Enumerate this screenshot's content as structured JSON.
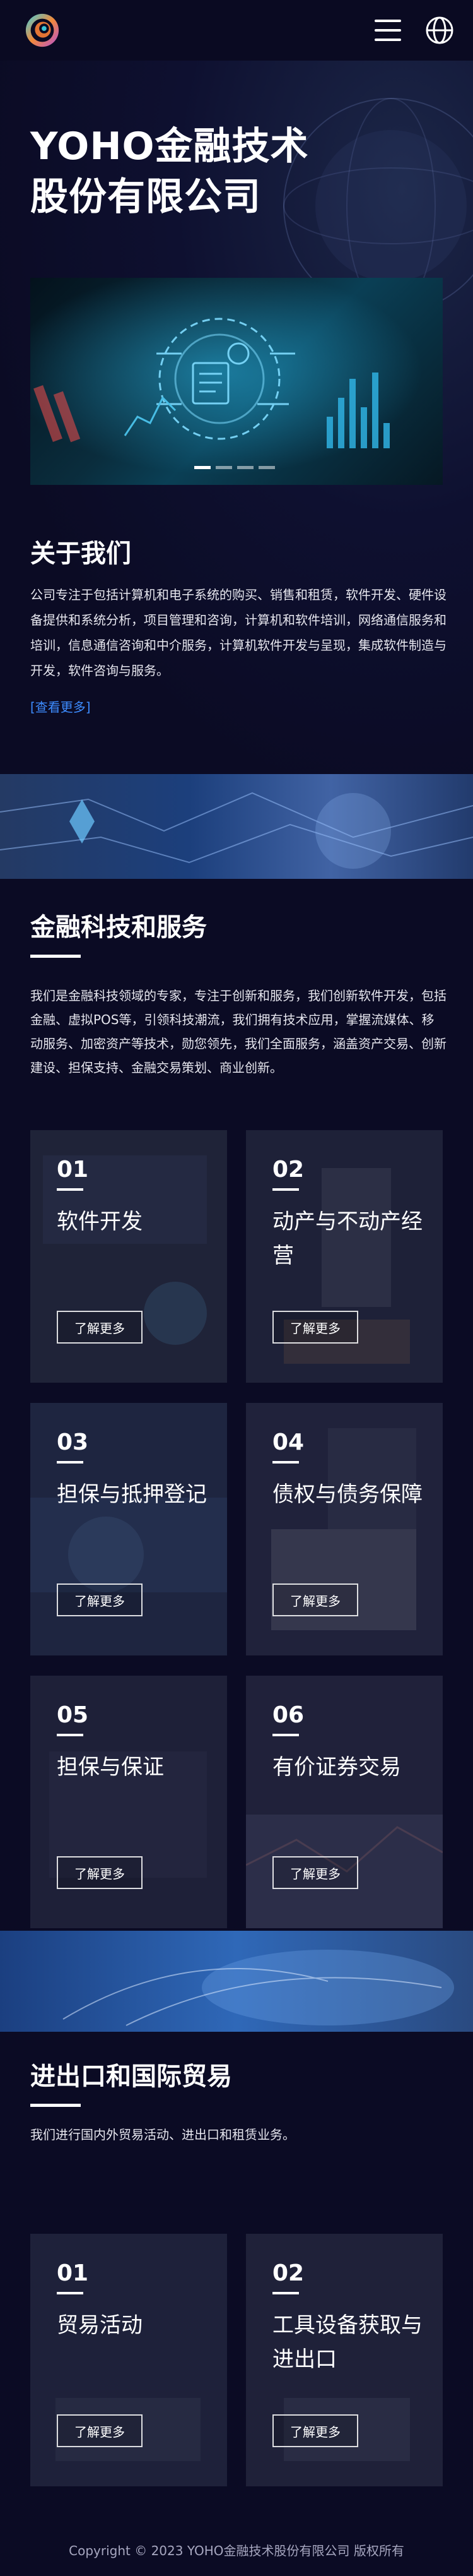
{
  "header": {
    "logo_icon": "swirl-logo-icon",
    "menu_icon": "hamburger-menu-icon",
    "language_icon": "globe-icon"
  },
  "hero": {
    "title_line1": "YOHO金融技术",
    "title_line2": "股份有限公司",
    "carousel_count": 4,
    "carousel_active": 1
  },
  "about": {
    "title": "关于我们",
    "text": "公司专注于包括计算机和电子系统的购买、销售和租赁，软件开发、硬件设备提供和系统分析，项目管理和咨询，计算机和软件培训，网络通信服务和培训，信息通信咨询和中介服务，计算机软件开发与呈现，集成软件制造与开发，软件咨询与服务。",
    "more_link": "[查看更多]"
  },
  "fintech": {
    "title": "金融科技和服务",
    "desc": "我们是金融科技领域的专家，专注于创新和服务，我们创新软件开发，包括金融、虚拟POS等，引领科技潮流，我们拥有技术应用，掌握流媒体、移动服务、加密资产等技术，勋您领先，我们全面服务，涵盖资产交易、创新建设、担保支持、金融交易策划、商业创新。",
    "cards": [
      {
        "num": "01",
        "title": "软件开发",
        "button": "了解更多"
      },
      {
        "num": "02",
        "title": "动产与不动产经营",
        "button": "了解更多"
      },
      {
        "num": "03",
        "title": "担保与抵押登记",
        "button": "了解更多"
      },
      {
        "num": "04",
        "title": "债权与债务保障",
        "button": "了解更多"
      },
      {
        "num": "05",
        "title": "担保与保证",
        "button": "了解更多"
      },
      {
        "num": "06",
        "title": "有价证券交易",
        "button": "了解更多"
      }
    ]
  },
  "trade": {
    "title": "进出口和国际贸易",
    "desc": "我们进行国内外贸易活动、进出口和租赁业务。",
    "cards": [
      {
        "num": "01",
        "title": "贸易活动",
        "button": "了解更多"
      },
      {
        "num": "02",
        "title": "工具设备获取与进出口",
        "button": "了解更多"
      }
    ]
  },
  "footer": {
    "copyright": "Copyright © 2023 YOHO金融技术股份有限公司 版权所有"
  },
  "colors": {
    "background": "#0b0b24",
    "link": "#3d8cff",
    "text": "#ffffff"
  }
}
